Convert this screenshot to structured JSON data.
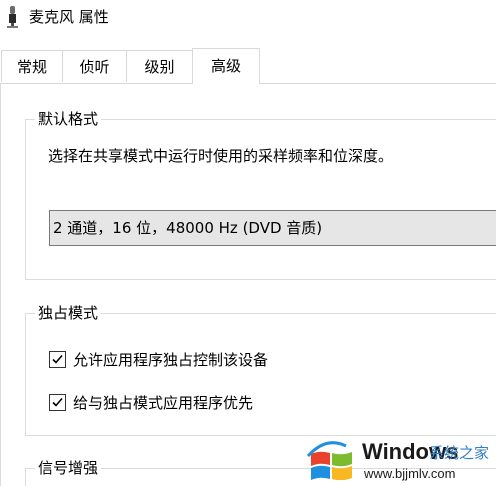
{
  "window": {
    "title": "麦克风 属性",
    "icon": "microphone-icon"
  },
  "tabs": [
    {
      "label": "常规",
      "active": false
    },
    {
      "label": "侦听",
      "active": false
    },
    {
      "label": "级别",
      "active": false
    },
    {
      "label": "高级",
      "active": true
    }
  ],
  "default_format": {
    "group_label": "默认格式",
    "description": "选择在共享模式中运行时使用的采样频率和位深度。",
    "selected_value": "2 通道，16 位，48000 Hz (DVD 音质)"
  },
  "exclusive_mode": {
    "group_label": "独占模式",
    "options": [
      {
        "label": "允许应用程序独占控制该设备",
        "checked": true
      },
      {
        "label": "给与独占模式应用程序优先",
        "checked": true
      }
    ]
  },
  "signal_enhancement": {
    "group_label": "信号增强"
  },
  "watermark": {
    "brand": "Windows",
    "site_name": "系统之家",
    "url": "www.bjjmlv.com",
    "colors": {
      "red": "#e8412c",
      "green": "#7cbb2d",
      "blue": "#1f8fe0",
      "yellow": "#f9b822"
    }
  }
}
